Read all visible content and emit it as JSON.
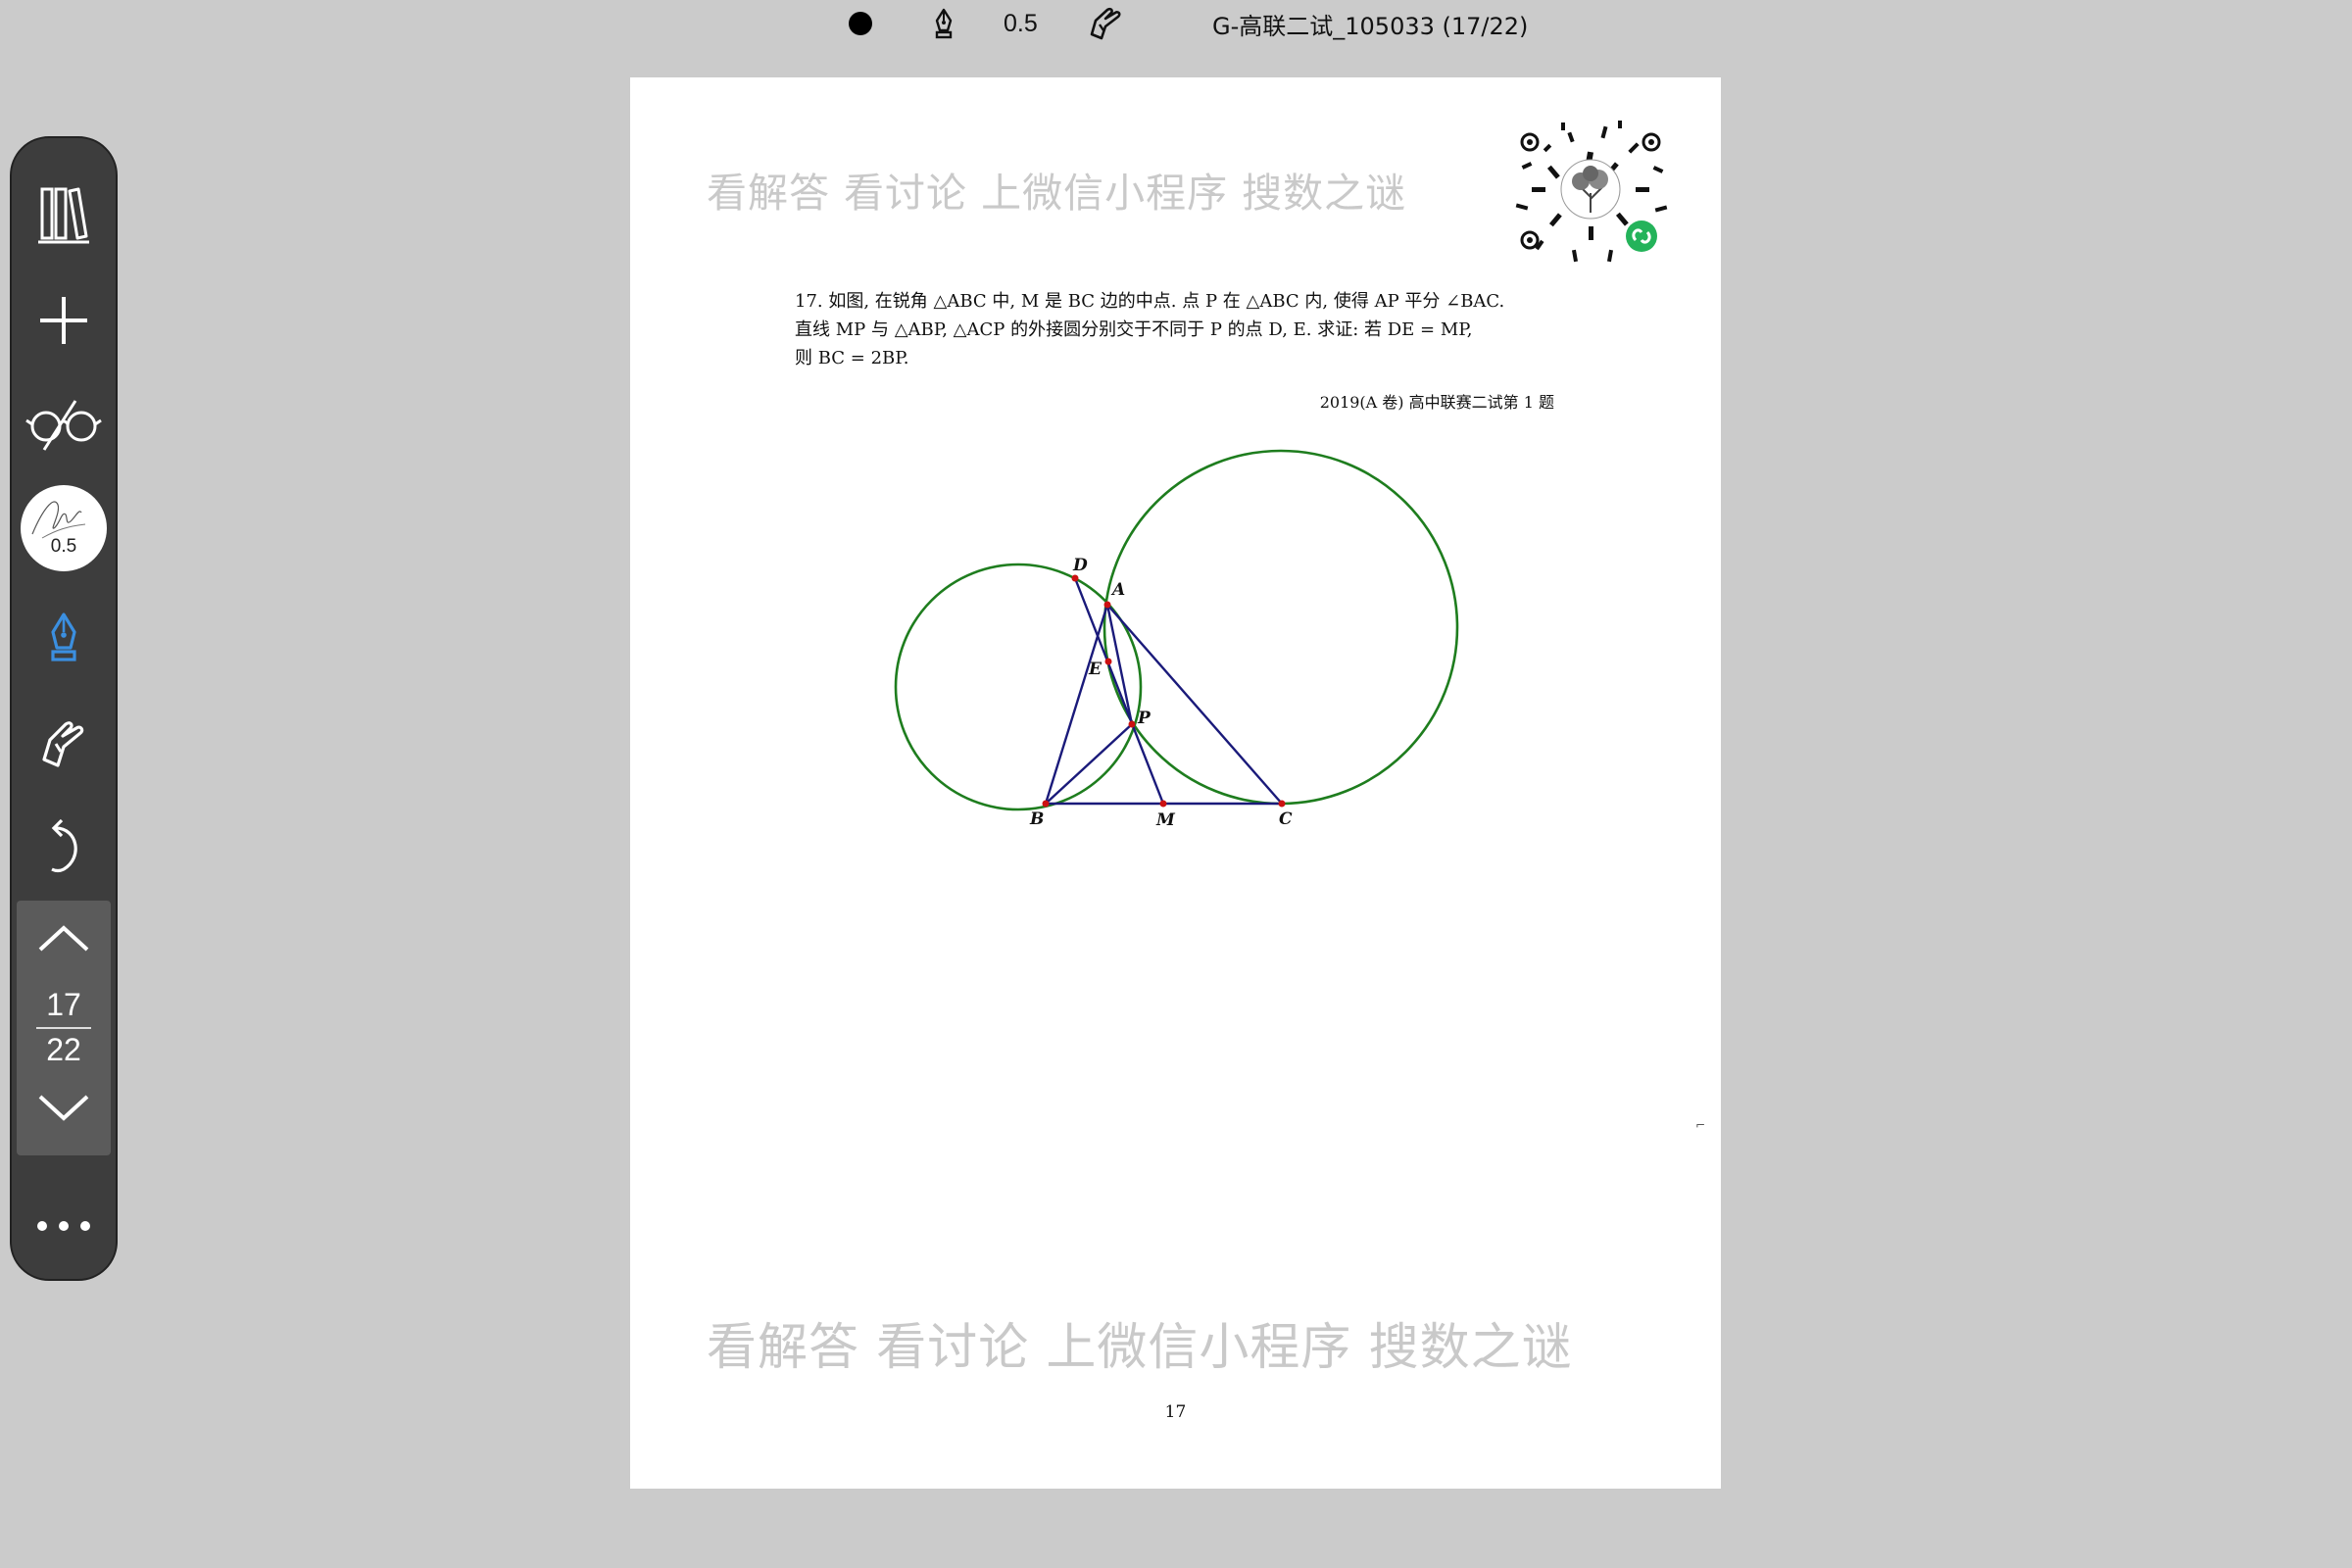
{
  "topbar": {
    "pen_size": "0.5",
    "document_title": "G-高联二试_105033 (17/22)"
  },
  "toolbar": {
    "brush_size": "0.5",
    "current_page": "17",
    "total_pages": "22"
  },
  "page": {
    "watermark_top": "看解答 看讨论 上微信小程序 搜数之谜",
    "watermark_bottom": "看解答 看讨论 上微信小程序 搜数之谜",
    "problem_line_1": "17.  如图, 在锐角 △ABC 中, M 是 BC 边的中点. 点 P 在 △ABC 内, 使得 AP 平分 ∠BAC.",
    "problem_line_2": "直线 MP 与 △ABP, △ACP 的外接圆分别交于不同于 P 的点 D, E. 求证: 若 DE = MP,",
    "problem_line_3": "则 BC = 2BP.",
    "source": "2019(A 卷) 高中联赛二试第 1 题",
    "page_number": "17",
    "figure_labels": {
      "A": "A",
      "B": "B",
      "C": "C",
      "D": "D",
      "E": "E",
      "M": "M",
      "P": "P"
    }
  },
  "colors": {
    "circle": "#1e7d1e",
    "segment": "#1a1a7a",
    "point": "#cc1111",
    "pen_active": "#3b8fe0"
  }
}
